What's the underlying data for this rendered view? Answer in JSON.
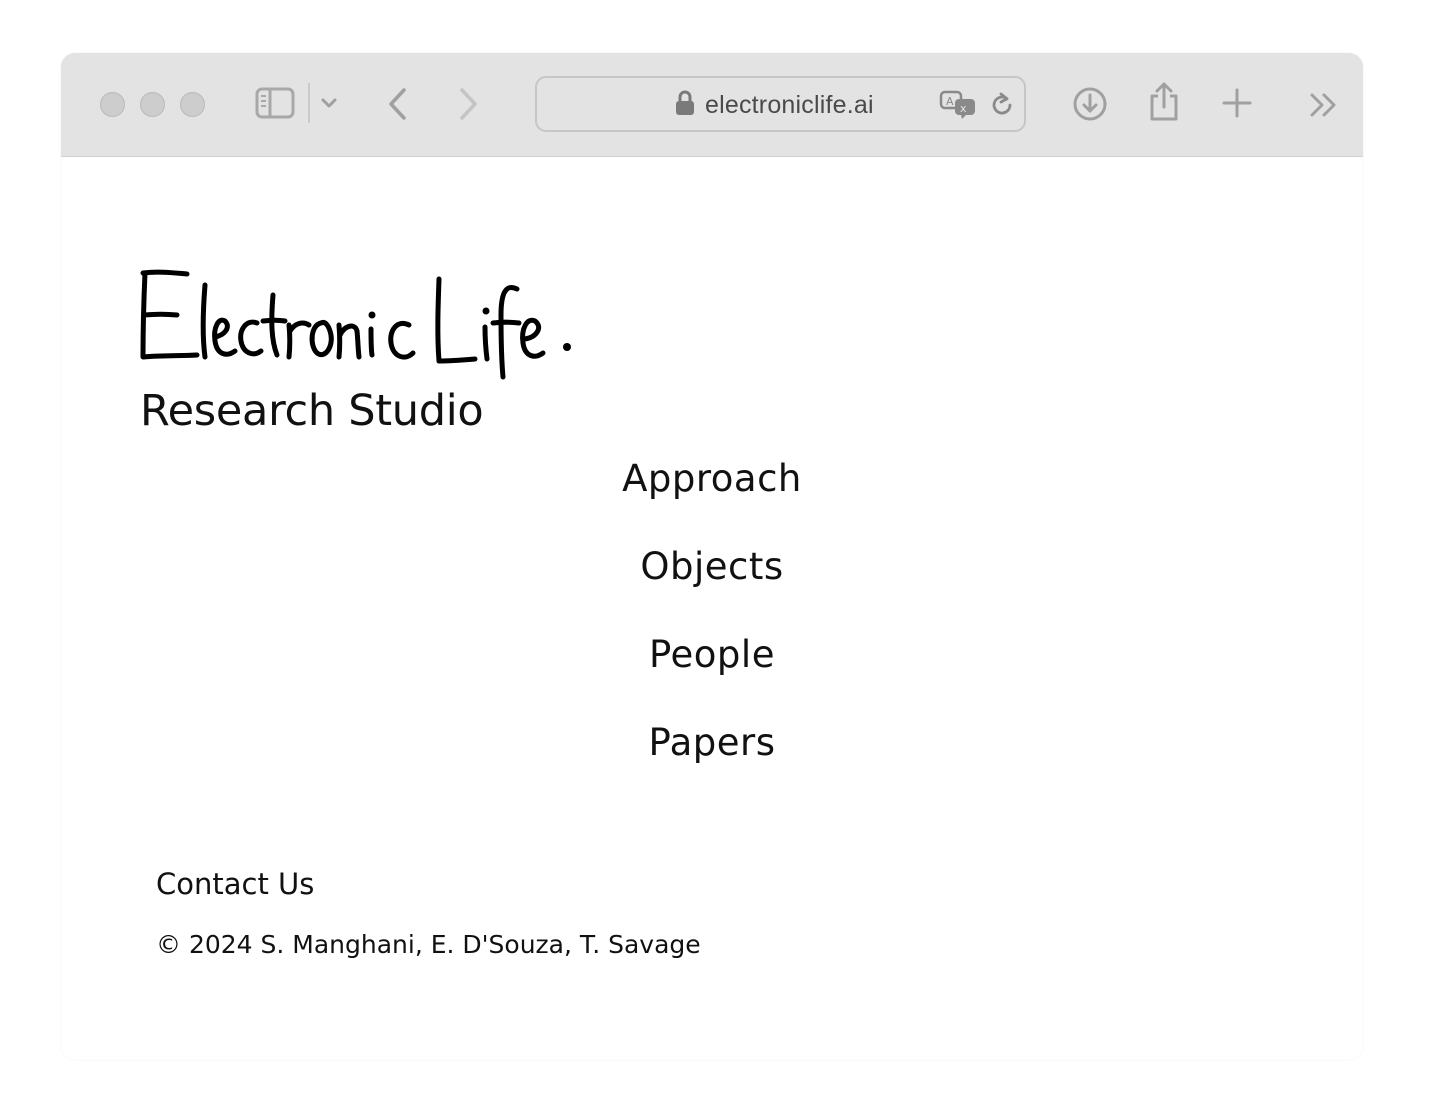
{
  "browser": {
    "url": "electroniclife.ai",
    "icons": {
      "sidebar": "sidebar-icon",
      "chevron": "chevron-down-icon",
      "back": "back-arrow-icon",
      "forward": "forward-arrow-icon",
      "lock": "lock-icon",
      "translate": "translate-icon",
      "reload": "reload-icon",
      "download": "download-icon",
      "share": "share-icon",
      "new_tab": "plus-icon",
      "overflow": "double-chevron-icon"
    }
  },
  "site": {
    "logo_text": "ElectronicLife.",
    "subtitle": "Research Studio",
    "nav": [
      "Approach",
      "Objects",
      "People",
      "Papers"
    ],
    "contact": "Contact Us",
    "copyright": "© 2024 S. Manghani, E. D'Souza, T. Savage"
  },
  "colors": {
    "chrome": "#e3e3e3",
    "text": "#111111",
    "icon": "#a8a8a8"
  }
}
